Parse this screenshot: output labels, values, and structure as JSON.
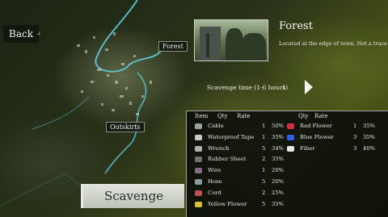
{
  "nav": {
    "back_label": "Back"
  },
  "map": {
    "labels": {
      "forest": "Forest",
      "outskirts": "Outskirts"
    }
  },
  "location": {
    "title": "Forest",
    "description": "Located at the edge of town. Not a trace of th",
    "image_alt": "forest-building-photo"
  },
  "scavenge": {
    "time_label": "Scavenge time (1-6 hours)",
    "time_value": "1",
    "button_label": "Scavenge"
  },
  "items_table": {
    "headers_left": {
      "item": "Item",
      "qty": "Qty",
      "rate": "Rate"
    },
    "headers_right": {
      "qty": "Qty",
      "rate": "Rate"
    },
    "left": [
      {
        "name": "Cable",
        "qty": "1",
        "rate": "50%",
        "icon": "cable-icon",
        "color": "#9aa0a0"
      },
      {
        "name": "Waterproof Tape",
        "qty": "1",
        "rate": "35%",
        "icon": "tape-icon",
        "color": "#c8c8c8"
      },
      {
        "name": "Wrench",
        "qty": "5",
        "rate": "34%",
        "icon": "wrench-icon",
        "color": "#b0b0b0"
      },
      {
        "name": "Rubber Sheet",
        "qty": "2",
        "rate": "35%",
        "icon": "rubber-sheet-icon",
        "color": "#707070"
      },
      {
        "name": "Wire",
        "qty": "1",
        "rate": "20%",
        "icon": "wire-icon",
        "color": "#8a6a8a"
      },
      {
        "name": "Hose",
        "qty": "5",
        "rate": "20%",
        "icon": "hose-icon",
        "color": "#8a9aa0"
      },
      {
        "name": "Cord",
        "qty": "2",
        "rate": "25%",
        "icon": "cord-icon",
        "color": "#c05050"
      },
      {
        "name": "Yellow Flower",
        "qty": "5",
        "rate": "35%",
        "icon": "yellow-flower-icon",
        "color": "#d8c030"
      }
    ],
    "right": [
      {
        "name": "Red Flower",
        "qty": "1",
        "rate": "35%",
        "icon": "red-flower-icon",
        "color": "#d03040"
      },
      {
        "name": "Blue Flower",
        "qty": "3",
        "rate": "35%",
        "icon": "blue-flower-icon",
        "color": "#3060e0"
      },
      {
        "name": "Fiber",
        "qty": "3",
        "rate": "40%",
        "icon": "fiber-icon",
        "color": "#e8e8e8"
      }
    ]
  }
}
